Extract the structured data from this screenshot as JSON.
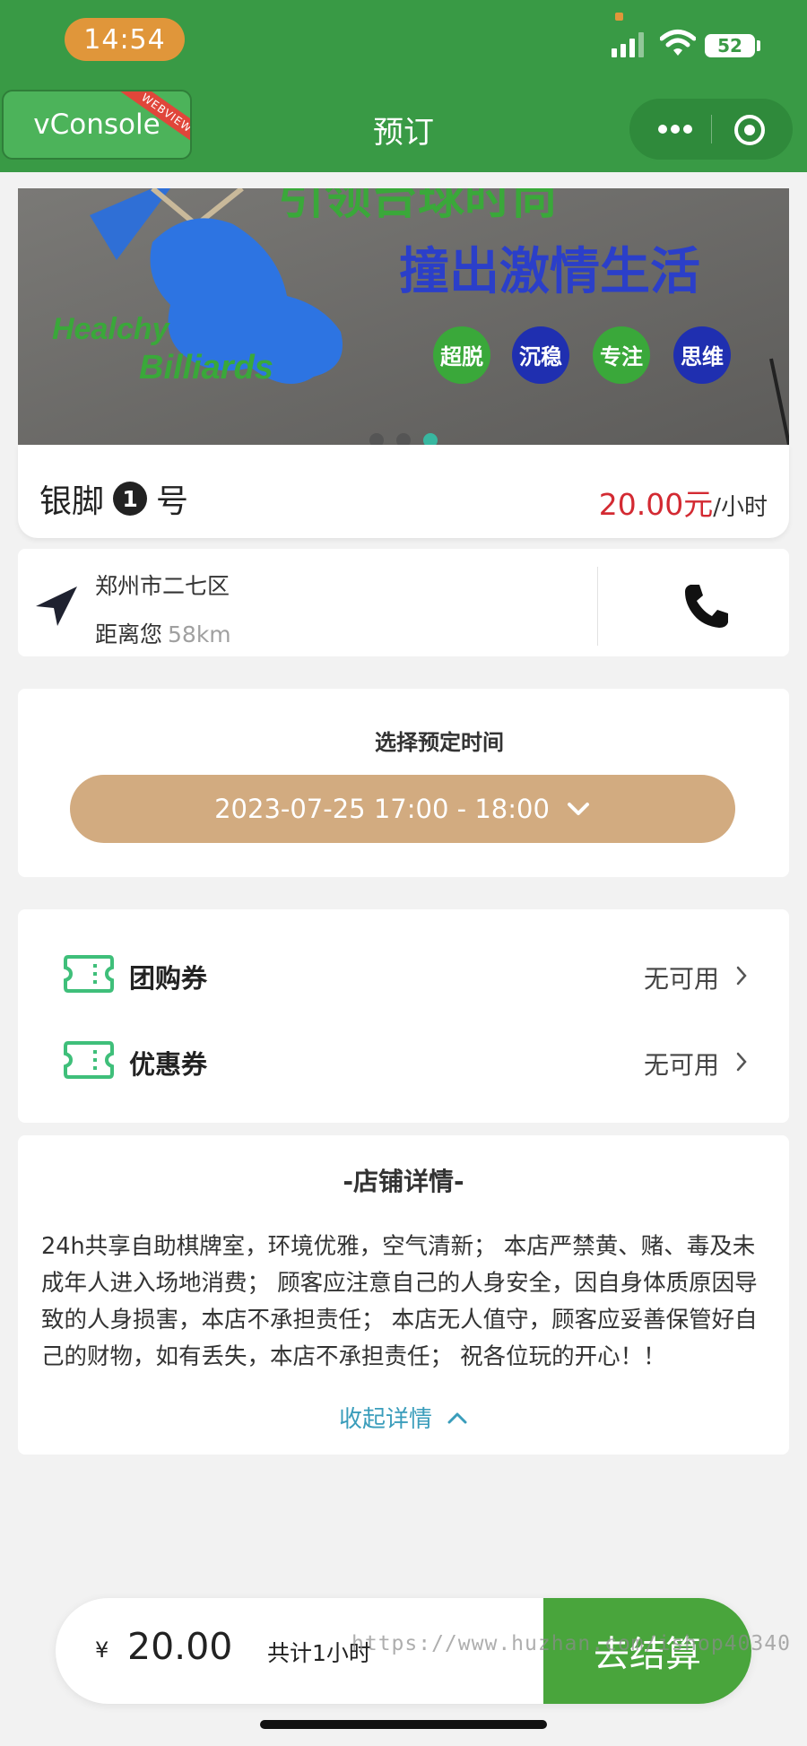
{
  "status_bar": {
    "time": "14:54",
    "battery": "52"
  },
  "nav": {
    "vconsole_label": "vConsole",
    "vconsole_badge": "WEBVIEW",
    "title": "预订"
  },
  "banner": {
    "slogan_top": "引领台球时尚",
    "slogan_main": "撞出激情生活",
    "brand_line1": "Healchy",
    "brand_line2": "Billiards",
    "badges": [
      "超脱",
      "沉稳",
      "专注",
      "思维"
    ],
    "carousel": {
      "count": 3,
      "active_index": 2
    }
  },
  "product": {
    "name_prefix": "银脚",
    "number": "1",
    "name_suffix": "号",
    "price": "20.00元",
    "unit": "/小时"
  },
  "location": {
    "city": "郑州市二七区",
    "distance_label": "距离您",
    "distance": "58km"
  },
  "booking": {
    "label": "选择预定时间",
    "time_range": "2023-07-25 17:00 - 18:00"
  },
  "coupons": [
    {
      "label": "团购券",
      "value": "无可用"
    },
    {
      "label": "优惠券",
      "value": "无可用"
    }
  ],
  "store": {
    "title": "-店铺详情-",
    "description": "24h共享自助棋牌室，环境优雅，空气清新；  本店严禁黄、赌、毒及未成年人进入场地消费；  顾客应注意自己的人身安全，因自身体质原因导致的人身损害，本店不承担责任；  本店无人值守，顾客应妥善保管好自己的财物，如有丢失，本店不承担责任；  祝各位玩的开心！！",
    "collapse_label": "收起详情"
  },
  "checkout": {
    "currency": "¥",
    "total": "20.00",
    "duration": "共计1小时",
    "button": "去结算"
  },
  "watermark": "https://www.huzhan.com/ishop40340",
  "colors": {
    "header_green": "#399a45",
    "price_red": "#d32a32",
    "time_pill": "#d2ab80",
    "link_blue": "#3a9dbb",
    "coupon_icon": "#3fbf7a",
    "checkout_green": "#49a53c"
  },
  "icons": [
    "signal-icon",
    "wifi-icon",
    "more-dots-icon",
    "target-icon",
    "navigation-arrow-icon",
    "phone-icon",
    "chevron-down-icon",
    "ticket-icon",
    "chevron-right-icon",
    "chevron-up-icon"
  ]
}
